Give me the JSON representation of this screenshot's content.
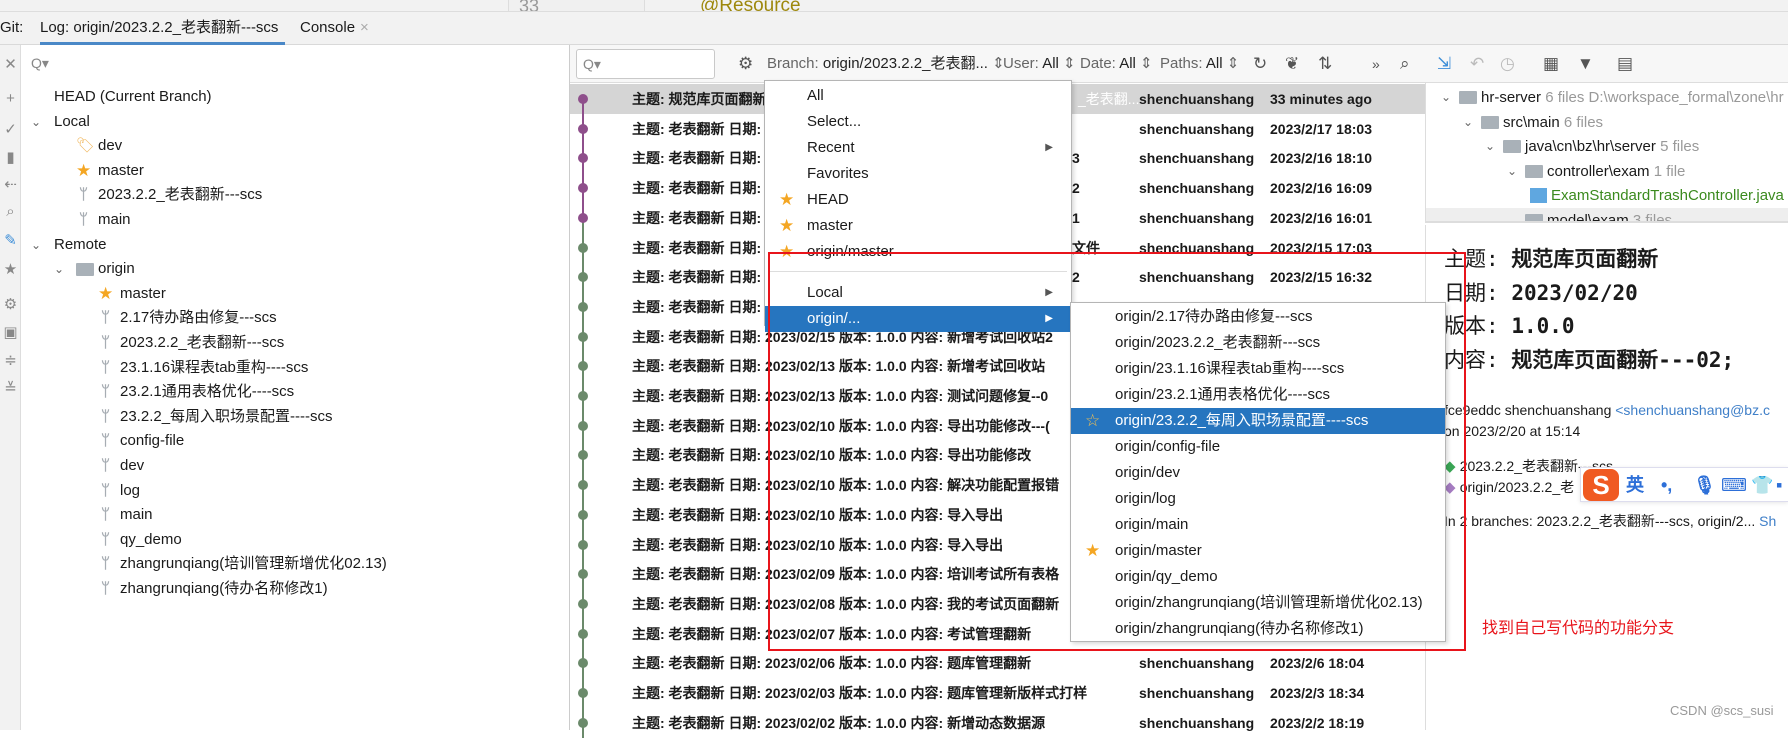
{
  "editor_strip": {
    "line_number": "33",
    "annotation": "@Resource"
  },
  "tabs": {
    "prefix": "Git:",
    "items": [
      {
        "label": "Log: origin/2023.2.2_老表翻新---scs",
        "active": true
      },
      {
        "label": "Console",
        "close": "×"
      }
    ]
  },
  "left_icons": [
    "close-icon",
    "plus-icon",
    "check-icon",
    "trash-icon",
    "merge-icon",
    "search-icon",
    "edit-icon",
    "star-icon",
    "gear-icon",
    "panel-icon",
    "expand-icon",
    "collapse-icon"
  ],
  "branch_search": {
    "placeholder": "Q▾"
  },
  "branch_tree": {
    "head": "HEAD (Current Branch)",
    "local_label": "Local",
    "local": [
      {
        "name": "dev",
        "icon": "tag-icon"
      },
      {
        "name": "master",
        "icon": "star-icon"
      },
      {
        "name": "2023.2.2_老表翻新---scs",
        "icon": "branch-icon"
      },
      {
        "name": "main",
        "icon": "branch-icon"
      }
    ],
    "remote_label": "Remote",
    "origin_label": "origin",
    "remote": [
      {
        "name": "master",
        "icon": "star-icon"
      },
      {
        "name": "2.17待办路由修复---scs",
        "icon": "branch-icon"
      },
      {
        "name": "2023.2.2_老表翻新---scs",
        "icon": "branch-icon"
      },
      {
        "name": "23.1.16课程表tab重构----scs",
        "icon": "branch-icon"
      },
      {
        "name": "23.2.1通用表格优化----scs",
        "icon": "branch-icon"
      },
      {
        "name": "23.2.2_每周入职场景配置----scs",
        "icon": "branch-icon"
      },
      {
        "name": "config-file",
        "icon": "branch-icon"
      },
      {
        "name": "dev",
        "icon": "branch-icon"
      },
      {
        "name": "log",
        "icon": "branch-icon"
      },
      {
        "name": "main",
        "icon": "branch-icon"
      },
      {
        "name": "qy_demo",
        "icon": "branch-icon"
      },
      {
        "name": "zhangrunqiang(培训管理新增优化02.13)",
        "icon": "branch-icon"
      },
      {
        "name": "zhangrunqiang(待办名称修改1)",
        "icon": "branch-icon"
      }
    ]
  },
  "log_toolbar": {
    "search_placeholder": "Q▾",
    "branch": {
      "label": "Branch:",
      "value": "origin/2023.2.2_老表翻..."
    },
    "user": {
      "label": "User:",
      "value": "All"
    },
    "date": {
      "label": "Date:",
      "value": "All"
    },
    "paths": {
      "label": "Paths:",
      "value": "All"
    },
    "more": "»"
  },
  "graph_colors": {
    "purple": "#8e4f8b",
    "green": "#6b8a6b"
  },
  "commits": [
    {
      "subject": "主题: 规范库页面翻新",
      "tail": "_老表翻...",
      "author": "shenchuanshang",
      "date": "33 minutes ago",
      "color": "purple",
      "selected": true
    },
    {
      "subject": "主题: 老表翻新 日期:",
      "tail": "",
      "author": "shenchuanshang",
      "date": "2023/2/17 18:03",
      "color": "purple"
    },
    {
      "subject": "主题: 老表翻新 日期:",
      "tail": "3",
      "author": "shenchuanshang",
      "date": "2023/2/16 18:10",
      "color": "purple"
    },
    {
      "subject": "主题: 老表翻新 日期:",
      "tail": "2",
      "author": "shenchuanshang",
      "date": "2023/2/16 16:09",
      "color": "purple"
    },
    {
      "subject": "主题: 老表翻新 日期:",
      "tail": "1",
      "author": "shenchuanshang",
      "date": "2023/2/16 16:01",
      "color": "purple"
    },
    {
      "subject": "主题: 老表翻新 日期:",
      "tail": "文件",
      "author": "shenchuanshang",
      "date": "2023/2/15 17:03",
      "color": "green"
    },
    {
      "subject": "主题: 老表翻新 日期:",
      "tail": "2",
      "author": "shenchuanshang",
      "date": "2023/2/15 16:32",
      "color": "green"
    },
    {
      "subject": "主题: 老表翻新 日期:",
      "tail": "",
      "author": "",
      "date": "",
      "color": "green"
    },
    {
      "subject": "主题: 老表翻新 日期: 2023/02/15 版本: 1.0.0 内容: 新增考试回收站2",
      "tail": "",
      "author": "",
      "date": "",
      "color": "green"
    },
    {
      "subject": "主题: 老表翻新 日期: 2023/02/13 版本: 1.0.0 内容: 新增考试回收站",
      "tail": "",
      "author": "",
      "date": "",
      "color": "green"
    },
    {
      "subject": "主题: 老表翻新 日期: 2023/02/13 版本: 1.0.0 内容: 测试问题修复--0",
      "tail": "",
      "author": "",
      "date": "",
      "color": "green"
    },
    {
      "subject": "主题: 老表翻新 日期: 2023/02/10 版本: 1.0.0 内容: 导出功能修改---(",
      "tail": "",
      "author": "",
      "date": "",
      "color": "green"
    },
    {
      "subject": "主题: 老表翻新 日期: 2023/02/10 版本: 1.0.0 内容: 导出功能修改",
      "tail": "",
      "author": "",
      "date": "",
      "color": "green"
    },
    {
      "subject": "主题: 老表翻新 日期: 2023/02/10 版本: 1.0.0 内容: 解决功能配置报错",
      "tail": "",
      "author": "",
      "date": "",
      "color": "green"
    },
    {
      "subject": "主题: 老表翻新 日期: 2023/02/10 版本: 1.0.0 内容: 导入导出",
      "tail": "",
      "author": "",
      "date": "",
      "color": "green"
    },
    {
      "subject": "主题: 老表翻新 日期: 2023/02/10 版本: 1.0.0 内容: 导入导出",
      "tail": "",
      "author": "",
      "date": "",
      "color": "green"
    },
    {
      "subject": "主题: 老表翻新 日期: 2023/02/09 版本: 1.0.0 内容: 培训考试所有表格",
      "tail": "",
      "author": "",
      "date": "",
      "color": "green"
    },
    {
      "subject": "主题: 老表翻新 日期: 2023/02/08 版本: 1.0.0 内容: 我的考试页面翻新",
      "tail": "",
      "author": "",
      "date": "",
      "color": "green"
    },
    {
      "subject": "主题: 老表翻新 日期: 2023/02/07 版本: 1.0.0 内容:  考试管理翻新",
      "tail": "",
      "author": "",
      "date": "",
      "color": "green"
    },
    {
      "subject": "主题: 老表翻新 日期: 2023/02/06 版本: 1.0.0 内容: 题库管理翻新",
      "tail": "",
      "author": "shenchuanshang",
      "date": "2023/2/6 18:04",
      "color": "green"
    },
    {
      "subject": "主题: 老表翻新 日期: 2023/02/03 版本: 1.0.0 内容: 题库管理新版样式打样",
      "tail": "",
      "author": "shenchuanshang",
      "date": "2023/2/3 18:34",
      "color": "green"
    },
    {
      "subject": "主题: 老表翻新 日期: 2023/02/02 版本: 1.0.0 内容: 新增动态数据源",
      "tail": "",
      "author": "shenchuanshang",
      "date": "2023/2/2 18:19",
      "color": "green"
    }
  ],
  "branch_menu": {
    "items": [
      {
        "label": "All"
      },
      {
        "label": "Select..."
      },
      {
        "label": "Recent",
        "submenu": true
      },
      {
        "label": "Favorites"
      },
      {
        "label": "HEAD",
        "star": true
      },
      {
        "label": "master",
        "star": true
      },
      {
        "label": "origin/master",
        "star": true
      },
      {
        "separator": true
      },
      {
        "label": "Local",
        "submenu": true
      },
      {
        "label": "origin/...",
        "submenu": true,
        "highlighted": true
      }
    ]
  },
  "origin_submenu": {
    "items": [
      {
        "label": "origin/2.17待办路由修复---scs"
      },
      {
        "label": "origin/2023.2.2_老表翻新---scs"
      },
      {
        "label": "origin/23.1.16课程表tab重构----scs"
      },
      {
        "label": "origin/23.2.1通用表格优化----scs"
      },
      {
        "label": "origin/23.2.2_每周入职场景配置----scs",
        "highlighted": true,
        "star": "outline"
      },
      {
        "label": "origin/config-file"
      },
      {
        "label": "origin/dev"
      },
      {
        "label": "origin/log"
      },
      {
        "label": "origin/main"
      },
      {
        "label": "origin/master",
        "star": "filled"
      },
      {
        "label": "origin/qy_demo"
      },
      {
        "label": "origin/zhangrunqiang(培训管理新增优化02.13)"
      },
      {
        "label": "origin/zhangrunqiang(待办名称修改1)"
      }
    ]
  },
  "annotation": {
    "text": "找到自己写代码的功能分支",
    "color": "#e8141b"
  },
  "changes_tree": [
    {
      "name": "hr-server",
      "count": "6 files",
      "path": "D:\\workspace_formal\\zone\\hr",
      "depth": 0
    },
    {
      "name": "src\\main",
      "count": "6 files",
      "depth": 1
    },
    {
      "name": "java\\cn\\bz\\hr\\server",
      "count": "5 files",
      "depth": 2
    },
    {
      "name": "controller\\exam",
      "count": "1 file",
      "depth": 3
    },
    {
      "name": "ExamStandardTrashController.java",
      "depth": 4,
      "file": true
    },
    {
      "name": "model\\exam",
      "count": "3 files",
      "depth": 3
    }
  ],
  "commit_detail": {
    "lines": [
      {
        "k": "主题:",
        "v": "规范库页面翻新"
      },
      {
        "k": "日期:",
        "v": "2023/02/20"
      },
      {
        "k": "版本:",
        "v": "1.0.0"
      },
      {
        "k": "内容:",
        "v": "规范库页面翻新---02;"
      }
    ],
    "hash_author": "fce9eddc shenchuanshang",
    "email": "<shenchuanshang@bz.c",
    "on_date": "on 2023/2/20 at 15:14",
    "tags": [
      {
        "name": "2023.2.2_老表翻新---scs",
        "color": "#3aa655"
      },
      {
        "name": "origin/2023.2.2_老",
        "color": "#a57cc1"
      }
    ],
    "branches": "In 2 branches: 2023.2.2_老表翻新---scs, origin/2...",
    "show_link": "Sh"
  },
  "ime": {
    "logo": "S",
    "lang": "英",
    "punct": "•,",
    "items": [
      "mic-icon",
      "keyboard-icon",
      "skin-icon",
      "apps-icon"
    ]
  },
  "watermark": "CSDN @scs_susi"
}
